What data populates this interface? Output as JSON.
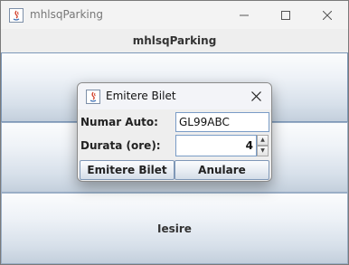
{
  "window": {
    "title": "mhlsqParking",
    "icon": "java-app-icon",
    "controls": {
      "minimize": "minimize-icon",
      "maximize": "maximize-icon",
      "close": "close-icon"
    }
  },
  "main": {
    "header": "mhlsqParking",
    "buttons": [
      {
        "label": ""
      },
      {
        "label": ""
      },
      {
        "label": "Iesire"
      }
    ]
  },
  "dialog": {
    "title": "Emitere Bilet",
    "icon": "java-app-icon",
    "fields": {
      "plate_label": "Numar Auto:",
      "plate_value": "GL99ABC",
      "duration_label": "Durata (ore):",
      "duration_value": "4"
    },
    "buttons": {
      "ok": "Emitere Bilet",
      "cancel": "Anulare"
    }
  }
}
